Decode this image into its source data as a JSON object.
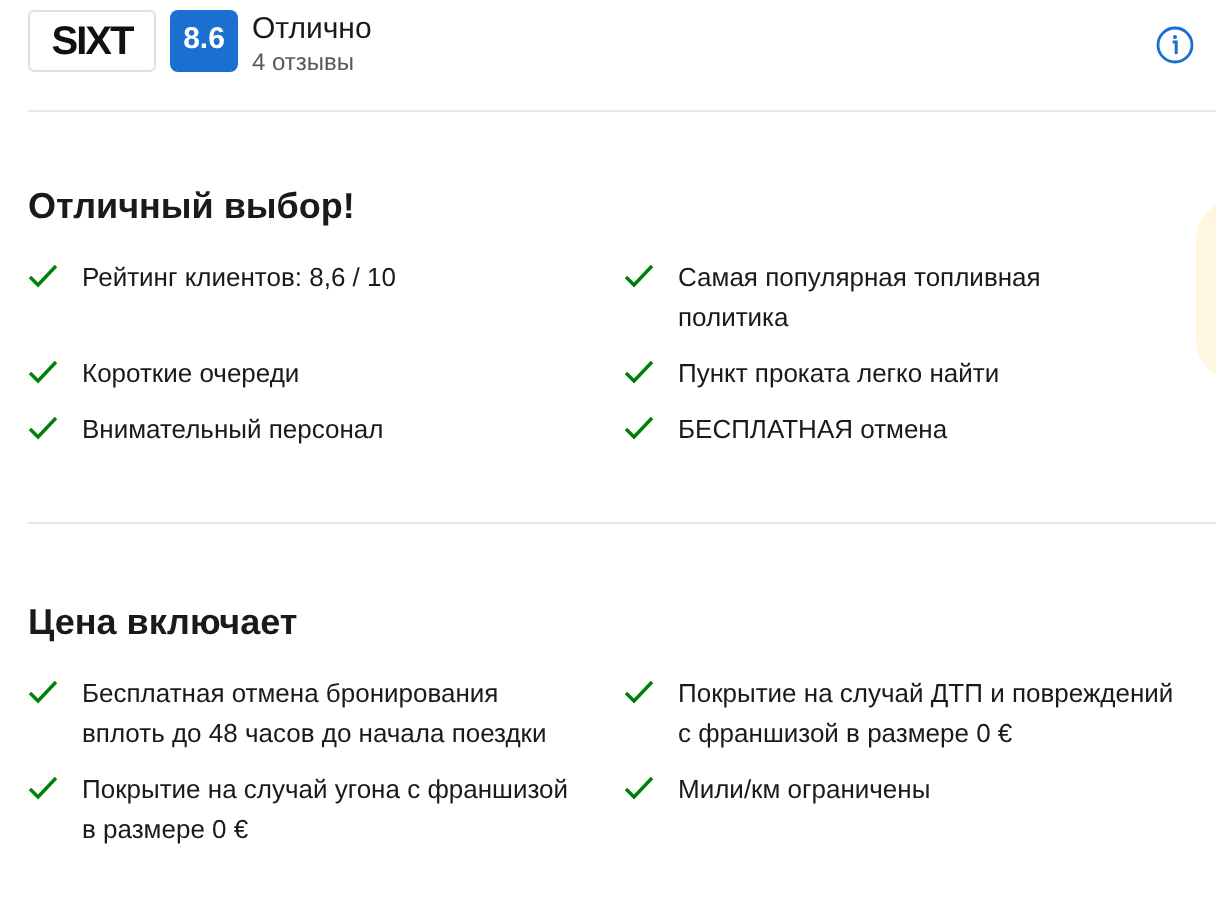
{
  "header": {
    "logo": "SIXT",
    "score": "8.6",
    "rating_label": "Отлично",
    "reviews": "4 отзывы"
  },
  "sections": [
    {
      "title": "Отличный выбор!",
      "items": [
        "Рейтинг клиентов: 8,6 / 10",
        "Самая популярная топливная политика",
        "Короткие очереди",
        "Пункт проката легко найти",
        "Внимательный персонал",
        "БЕСПЛАТНАЯ отмена"
      ]
    },
    {
      "title": "Цена включает",
      "items": [
        "Бесплатная отмена бронирования вплоть до 48 часов до начала поездки",
        "Покрытие на случай ДТП и повреждений с франшизой в размере 0 €",
        "Покрытие на случай угона с франшизой в размере 0 €",
        "Мили/км ограничены"
      ]
    }
  ]
}
